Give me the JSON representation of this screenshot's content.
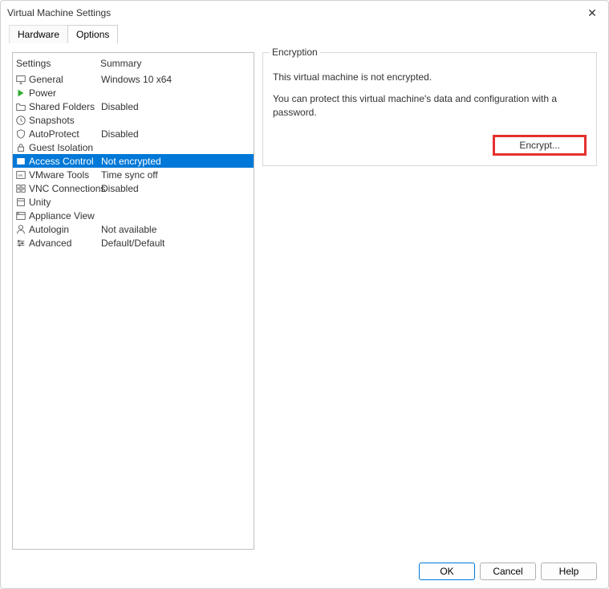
{
  "window": {
    "title": "Virtual Machine Settings"
  },
  "tabs": {
    "hardware": "Hardware",
    "options": "Options"
  },
  "list": {
    "headers": {
      "settings": "Settings",
      "summary": "Summary"
    },
    "items": [
      {
        "name": "General",
        "summary": "Windows 10 x64"
      },
      {
        "name": "Power",
        "summary": ""
      },
      {
        "name": "Shared Folders",
        "summary": "Disabled"
      },
      {
        "name": "Snapshots",
        "summary": ""
      },
      {
        "name": "AutoProtect",
        "summary": "Disabled"
      },
      {
        "name": "Guest Isolation",
        "summary": ""
      },
      {
        "name": "Access Control",
        "summary": "Not encrypted"
      },
      {
        "name": "VMware Tools",
        "summary": "Time sync off"
      },
      {
        "name": "VNC Connections",
        "summary": "Disabled"
      },
      {
        "name": "Unity",
        "summary": ""
      },
      {
        "name": "Appliance View",
        "summary": ""
      },
      {
        "name": "Autologin",
        "summary": "Not available"
      },
      {
        "name": "Advanced",
        "summary": "Default/Default"
      }
    ]
  },
  "encryption": {
    "groupLabel": "Encryption",
    "status": "This virtual machine is not encrypted.",
    "info": "You can protect this virtual machine's data and configuration with a password.",
    "button": "Encrypt..."
  },
  "buttons": {
    "ok": "OK",
    "cancel": "Cancel",
    "help": "Help"
  }
}
